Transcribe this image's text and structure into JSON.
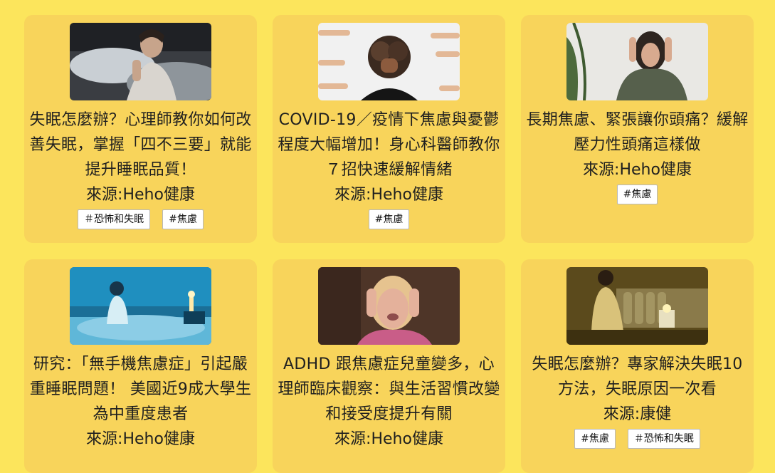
{
  "articles": [
    {
      "title": "失眠怎麼辦？心理師教你如何改善失眠，掌握「四不三要」就能提升睡眠品質！",
      "source": "來源:Heho健康",
      "tags": [
        "＃恐怖和失眠",
        "#焦慮"
      ],
      "image": "woman-awake-in-bed-photo"
    },
    {
      "title": "COVID-19／疫情下焦慮與憂鬱程度大幅增加！身心科醫師教你７招快速緩解情緒",
      "source": "來源:Heho健康",
      "tags": [
        "#焦慮"
      ],
      "image": "woman-surrounded-by-pointing-fingers-photo"
    },
    {
      "title": "長期焦慮、緊張讓你頭痛？緩解壓力性頭痛這樣做",
      "source": "來源:Heho健康",
      "tags": [
        "#焦慮"
      ],
      "image": "woman-holding-head-photo"
    },
    {
      "title": "研究：「無手機焦慮症」引起嚴重睡眠問題！ 美國近9成大學生為中重度患者",
      "source": "來源:Heho健康",
      "tags": [],
      "image": "person-sitting-in-bed-blue-light-photo"
    },
    {
      "title": "ADHD 跟焦慮症兒童變多，心理師臨床觀察：與生活習慣改變和接受度提升有關",
      "source": "來源:Heho健康",
      "tags": [],
      "image": "crying-girl-covering-ears-photo"
    },
    {
      "title": "失眠怎麼辦？專家解決失眠10方法，失眠原因一次看",
      "source": "來源:康健",
      "tags": [
        "#焦慮",
        "＃恐怖和失眠"
      ],
      "image": "man-sitting-on-bed-night-photo"
    }
  ]
}
